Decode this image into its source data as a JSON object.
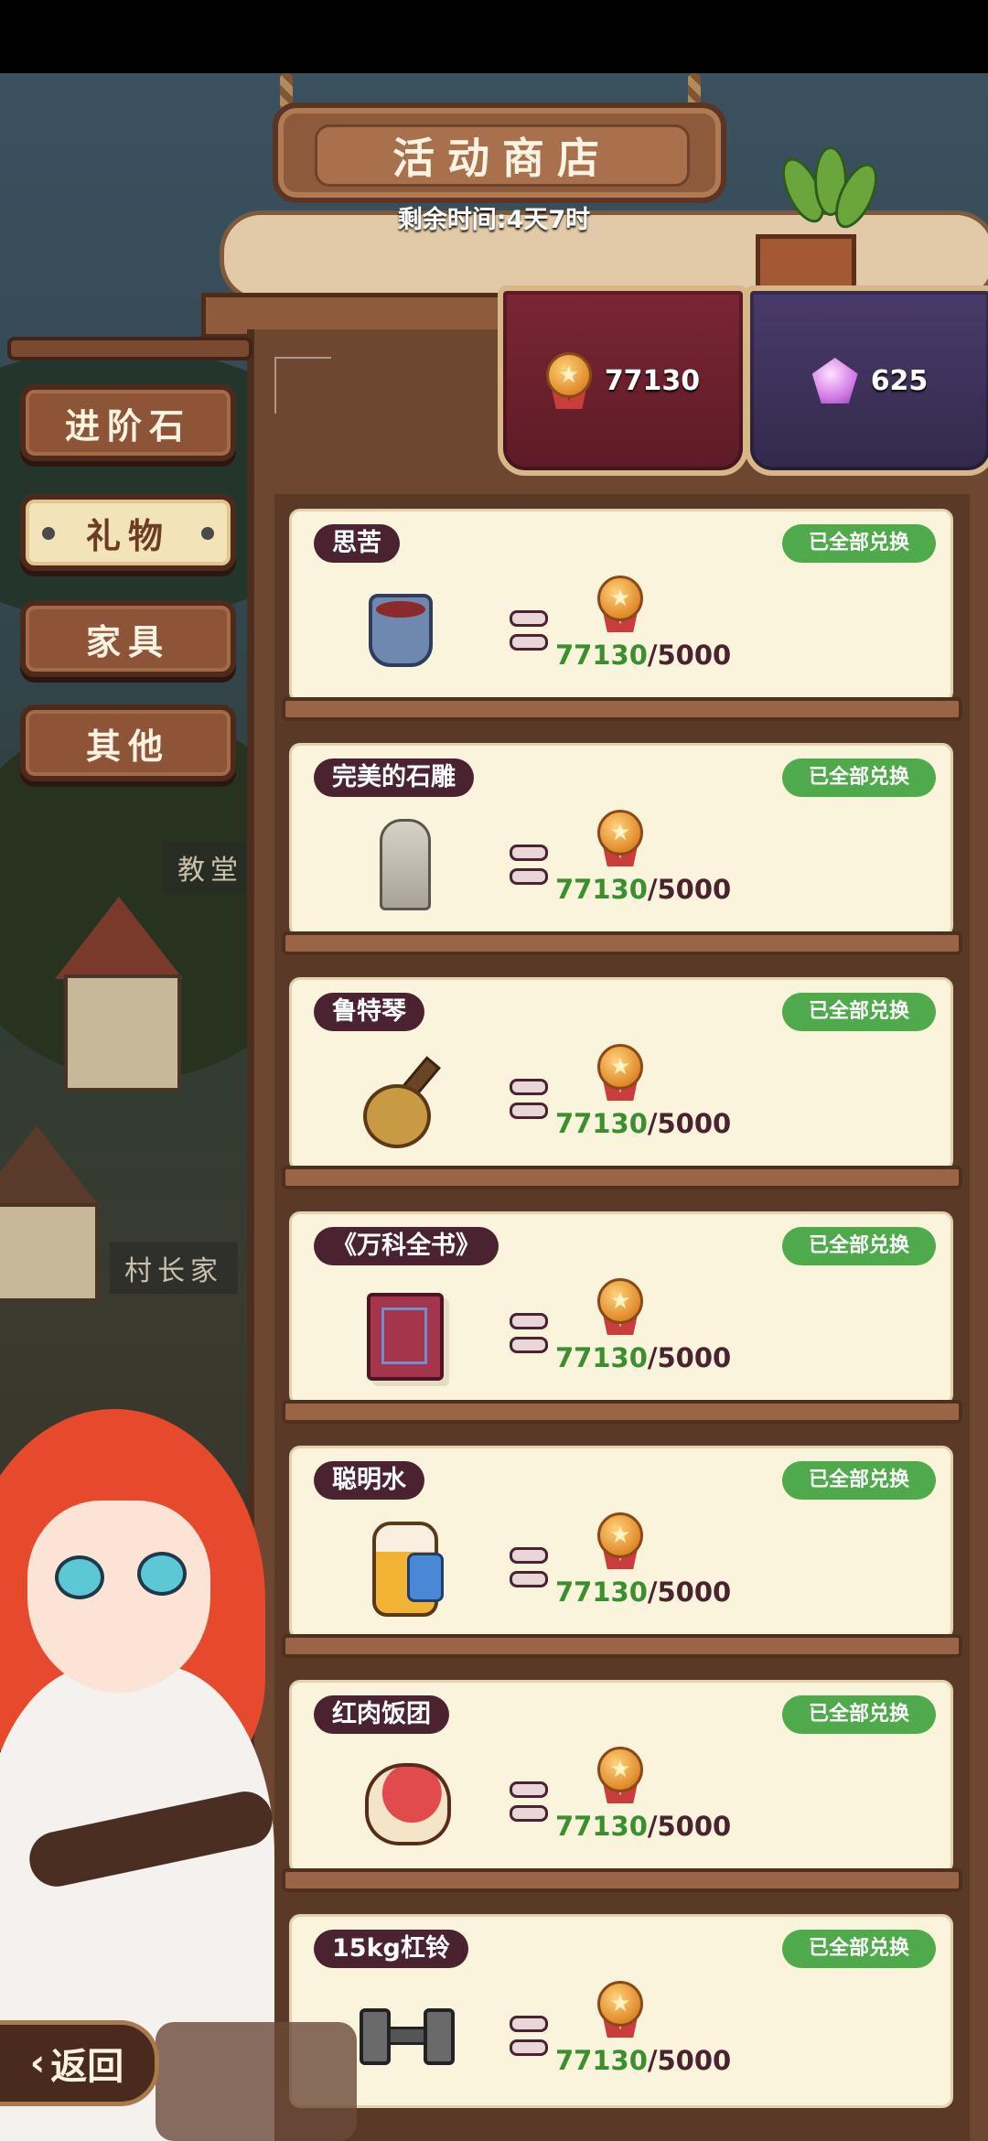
{
  "header": {
    "title": "活动商店",
    "timer": "剩余时间:4天7时"
  },
  "currencies": [
    {
      "name": "medal-icon",
      "value": "77130",
      "color": "#7b2533"
    },
    {
      "name": "gem-icon",
      "value": "625",
      "color": "#4a3a6a"
    }
  ],
  "tabs": [
    {
      "label": "进阶石",
      "active": false
    },
    {
      "label": "礼物",
      "active": true
    },
    {
      "label": "家具",
      "active": false
    },
    {
      "label": "其他",
      "active": false
    }
  ],
  "map_labels": [
    "教堂",
    "村长家"
  ],
  "items": [
    {
      "name": "思苦",
      "status": "已全部兑换",
      "have": "77130",
      "cost": "/5000",
      "icon": "cup-icon"
    },
    {
      "name": "完美的石雕",
      "status": "已全部兑换",
      "have": "77130",
      "cost": "/5000",
      "icon": "statue-icon"
    },
    {
      "name": "鲁特琴",
      "status": "已全部兑换",
      "have": "77130",
      "cost": "/5000",
      "icon": "lute-icon"
    },
    {
      "name": "《万科全书》",
      "status": "已全部兑换",
      "have": "77130",
      "cost": "/5000",
      "icon": "book-icon"
    },
    {
      "name": "聪明水",
      "status": "已全部兑换",
      "have": "77130",
      "cost": "/5000",
      "icon": "bottle-icon"
    },
    {
      "name": "红肉饭团",
      "status": "已全部兑换",
      "have": "77130",
      "cost": "/5000",
      "icon": "riceball-icon"
    },
    {
      "name": "15kg杠铃",
      "status": "已全部兑换",
      "have": "77130",
      "cost": "/5000",
      "icon": "dumbbell-icon"
    }
  ],
  "footer": {
    "back_label": "返回",
    "back_icon": "chevron-left-icon"
  },
  "colors": {
    "status_green": "#4eaa4a",
    "have_green": "#3a8f2e",
    "name_tag": "#4a2230",
    "card_bg": "#fbf4dd"
  }
}
